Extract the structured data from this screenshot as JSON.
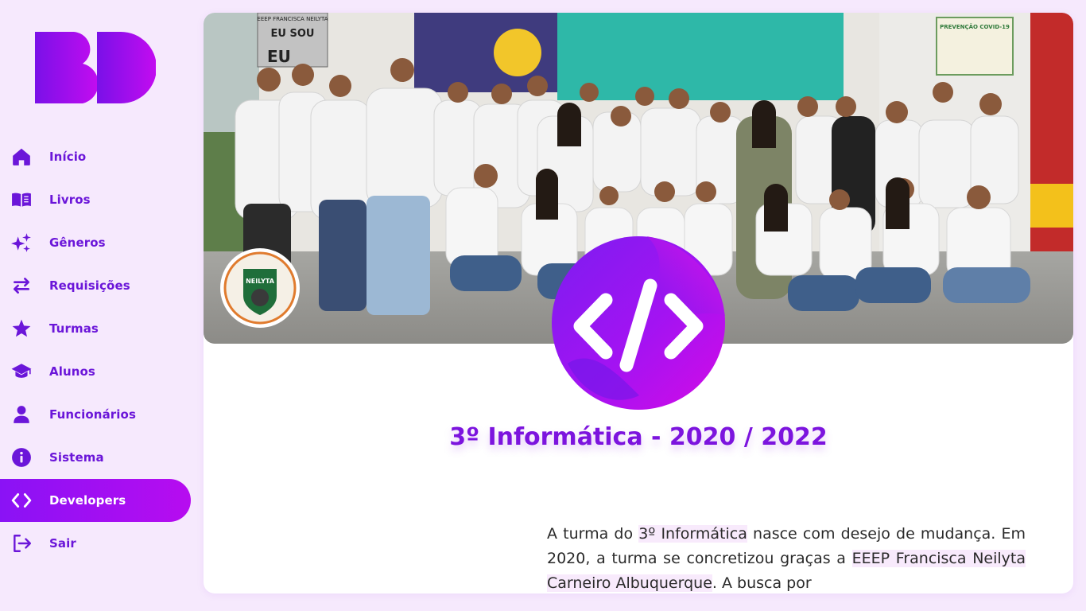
{
  "brand": {
    "logo_text": "BD",
    "colors": {
      "primary": "#6b16d9",
      "gradient_start": "#8a12f5",
      "gradient_end": "#c40cf0",
      "background": "#f6e9fd"
    }
  },
  "sidebar": {
    "items": [
      {
        "label": "Início",
        "icon": "home-icon",
        "active": false
      },
      {
        "label": "Livros",
        "icon": "book-open-icon",
        "active": false
      },
      {
        "label": "Gêneros",
        "icon": "sparkles-icon",
        "active": false
      },
      {
        "label": "Requisições",
        "icon": "arrows-exchange-icon",
        "active": false
      },
      {
        "label": "Turmas",
        "icon": "star-icon",
        "active": false
      },
      {
        "label": "Alunos",
        "icon": "graduation-cap-icon",
        "active": false
      },
      {
        "label": "Funcionários",
        "icon": "user-icon",
        "active": false
      },
      {
        "label": "Sistema",
        "icon": "info-icon",
        "active": false
      },
      {
        "label": "Developers",
        "icon": "code-icon",
        "active": true
      },
      {
        "label": "Sair",
        "icon": "logout-icon",
        "active": false
      }
    ]
  },
  "main": {
    "banner": {
      "image": "class-group-photo",
      "sign_text": [
        "EEEP FRANCISCA NEILYTA",
        "EU SOU",
        "EU"
      ],
      "poster_text": "PREVENÇÃO COVID-19",
      "school_seal_text": "NEILYTA"
    },
    "class_icon": "code-icon",
    "title": "3º Informática - 2020 / 2022",
    "description": {
      "part1": "A turma do ",
      "highlight1": "3º Informática",
      "part2": " nasce com desejo de mudança. Em 2020, a turma se concretizou graças a ",
      "highlight2": "EEEP Francisca Neilyta Carneiro Albuquerque",
      "part3": ". A busca por"
    }
  }
}
